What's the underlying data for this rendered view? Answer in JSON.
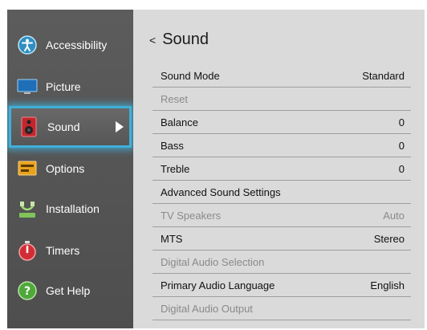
{
  "sidebar": {
    "items": [
      {
        "label": "Accessibility",
        "icon": "accessibility-icon"
      },
      {
        "label": "Picture",
        "icon": "picture-icon"
      },
      {
        "label": "Sound",
        "icon": "sound-icon",
        "active": true
      },
      {
        "label": "Options",
        "icon": "options-icon"
      },
      {
        "label": "Installation",
        "icon": "installation-icon"
      },
      {
        "label": "Timers",
        "icon": "timers-icon"
      },
      {
        "label": "Get Help",
        "icon": "get-help-icon"
      }
    ]
  },
  "main": {
    "back_symbol": "<",
    "title": "Sound",
    "rows": [
      {
        "label": "Sound Mode",
        "value": "Standard",
        "enabled": true
      },
      {
        "label": "Reset",
        "value": "",
        "enabled": false
      },
      {
        "label": "Balance",
        "value": "0",
        "enabled": true
      },
      {
        "label": "Bass",
        "value": "0",
        "enabled": true
      },
      {
        "label": "Treble",
        "value": "0",
        "enabled": true
      },
      {
        "label": "Advanced Sound Settings",
        "value": "",
        "enabled": true
      },
      {
        "label": "TV Speakers",
        "value": "Auto",
        "enabled": false
      },
      {
        "label": "MTS",
        "value": "Stereo",
        "enabled": true
      },
      {
        "label": "Digital Audio Selection",
        "value": "",
        "enabled": false
      },
      {
        "label": "Primary Audio Language",
        "value": "English",
        "enabled": true
      },
      {
        "label": "Digital Audio Output",
        "value": "",
        "enabled": false
      }
    ]
  },
  "colors": {
    "highlight": "#3fb0d9",
    "sidebar_bg": "#555555",
    "main_bg": "#dadada",
    "disabled_text": "#8a8a8a"
  }
}
